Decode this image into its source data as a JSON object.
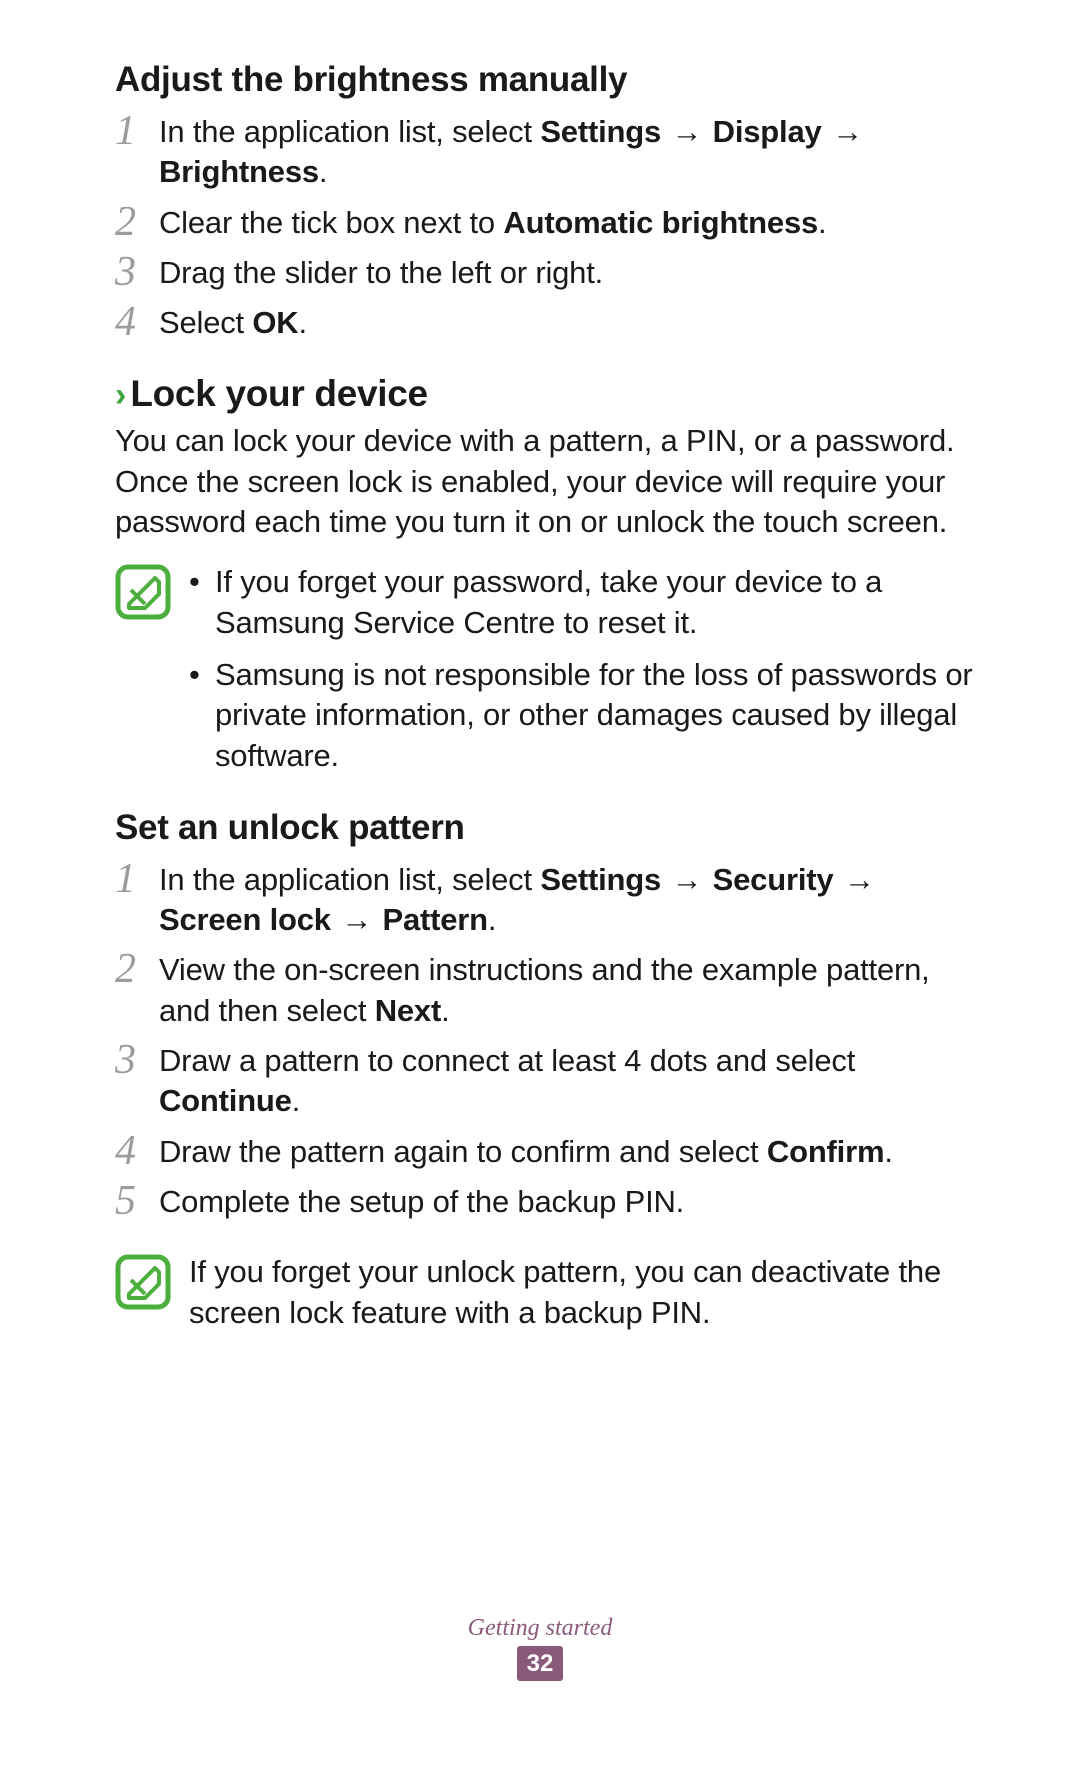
{
  "section1": {
    "title": "Adjust the brightness manually",
    "steps": {
      "s1": {
        "num": "1",
        "pre": "In the application list, select ",
        "b1": "Settings",
        "arr1": " → ",
        "b2": "Display",
        "arr2": " → ",
        "b3": "Brightness",
        "post": "."
      },
      "s2": {
        "num": "2",
        "pre": "Clear the tick box next to ",
        "b1": "Automatic brightness",
        "post": "."
      },
      "s3": {
        "num": "3",
        "text": "Drag the slider to the left or right."
      },
      "s4": {
        "num": "4",
        "pre": "Select ",
        "b1": "OK",
        "post": "."
      }
    }
  },
  "section2": {
    "chevron": "›",
    "title": "Lock your device",
    "intro": "You can lock your device with a pattern, a PIN, or a password. Once the screen lock is enabled, your device will require your password each time you turn it on or unlock the touch screen.",
    "notes": {
      "n1": "If you forget your password, take your device to a Samsung Service Centre to reset it.",
      "n2": "Samsung is not responsible for the loss of passwords or private information, or other damages caused by illegal software."
    }
  },
  "section3": {
    "title": "Set an unlock pattern",
    "steps": {
      "s1": {
        "num": "1",
        "pre": "In the application list, select ",
        "b1": "Settings",
        "arr1": " → ",
        "b2": "Security",
        "arr2": " → ",
        "b3": "Screen lock",
        "arr3": " → ",
        "b4": "Pattern",
        "post": "."
      },
      "s2": {
        "num": "2",
        "pre": "View the on-screen instructions and the example pattern, and then select ",
        "b1": "Next",
        "post": "."
      },
      "s3": {
        "num": "3",
        "pre": "Draw a pattern to connect at least 4 dots and select ",
        "b1": "Continue",
        "post": "."
      },
      "s4": {
        "num": "4",
        "pre": "Draw the pattern again to confirm and select ",
        "b1": "Confirm",
        "post": "."
      },
      "s5": {
        "num": "5",
        "text": "Complete the setup of the backup PIN."
      }
    },
    "note": "If you forget your unlock pattern, you can deactivate the screen lock feature with a backup PIN."
  },
  "footer": {
    "label": "Getting started",
    "page": "32"
  }
}
